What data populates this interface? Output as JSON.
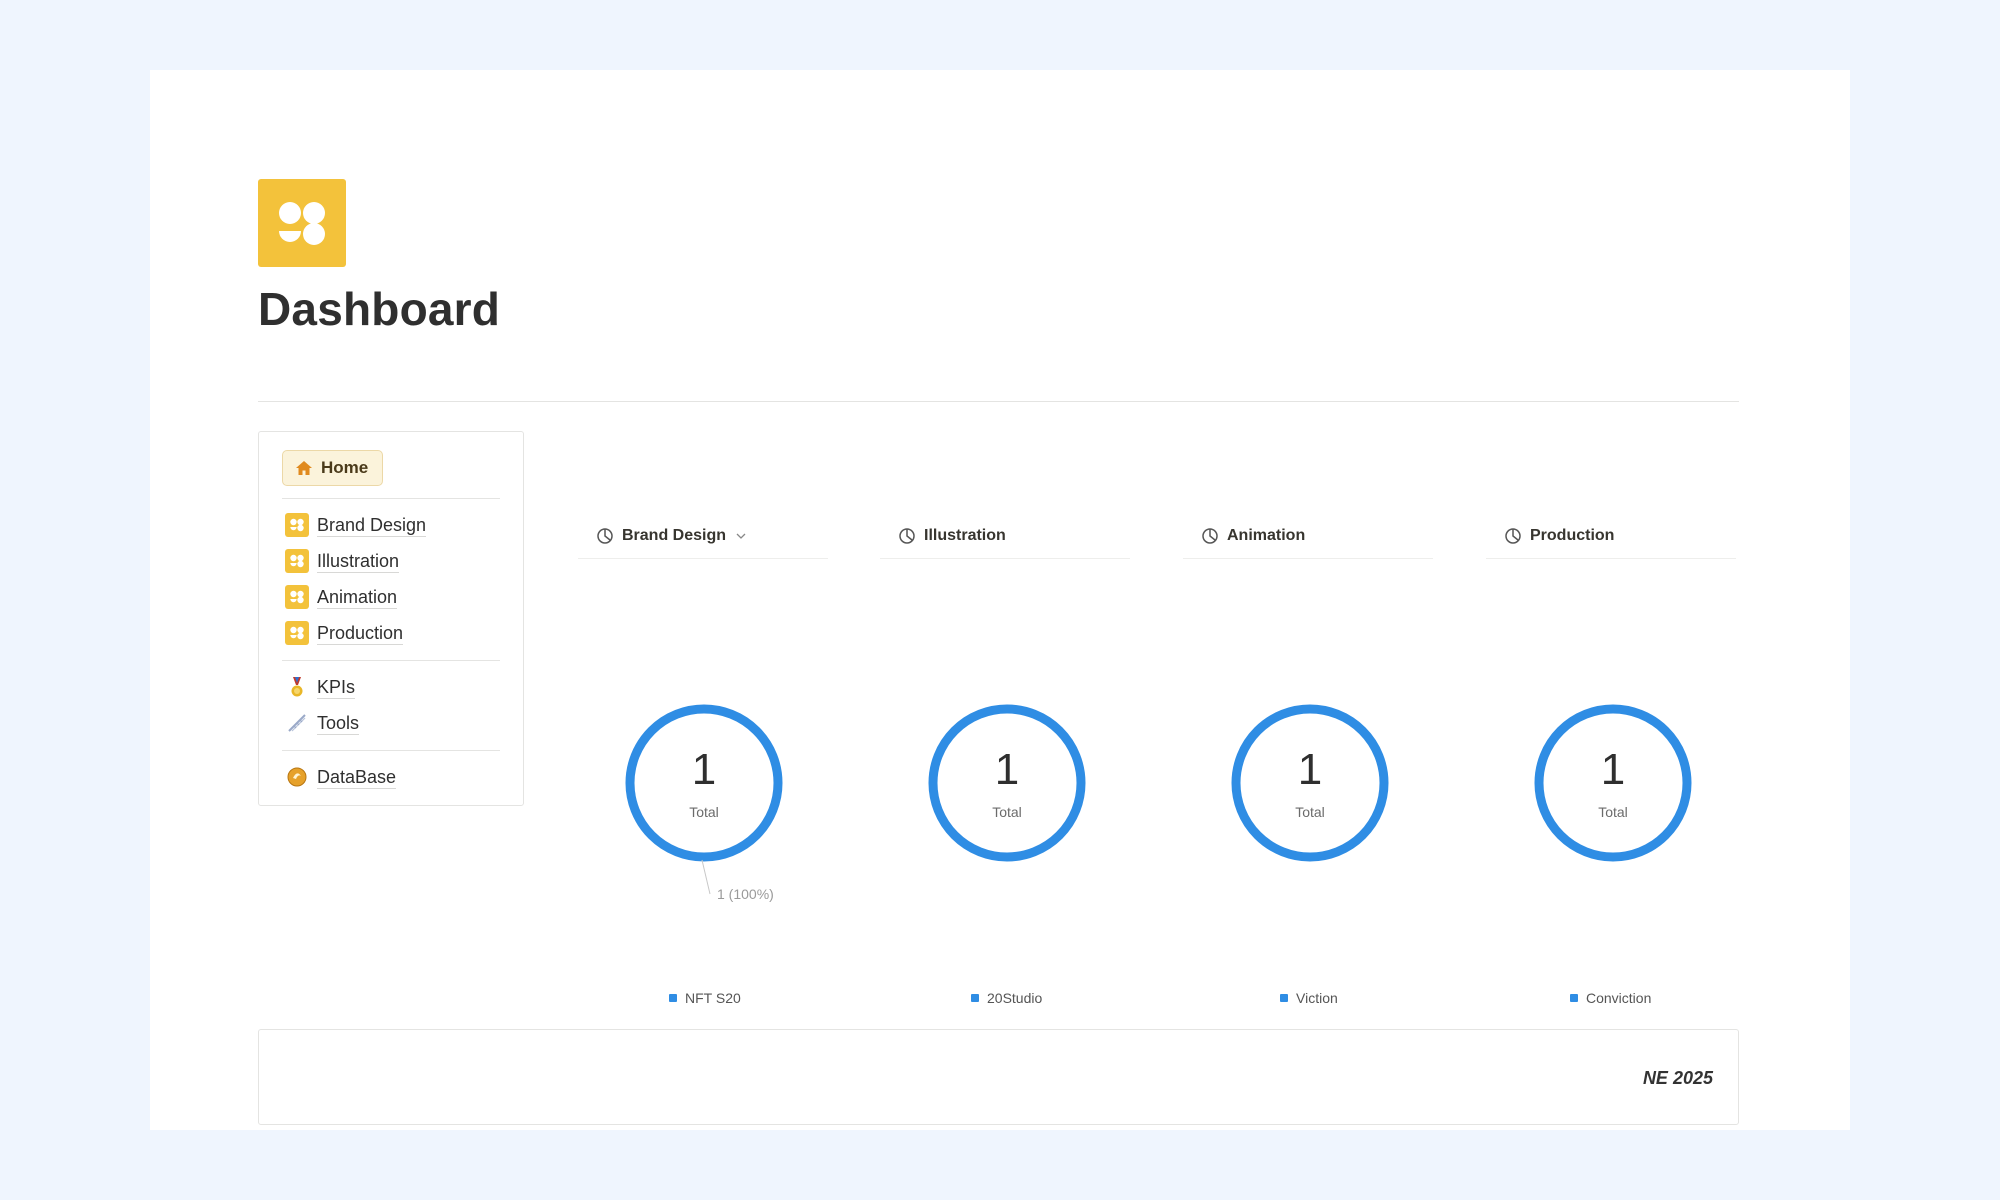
{
  "page": {
    "title": "Dashboard",
    "logo_icon": "yellow-dots-logo"
  },
  "nav": {
    "home": {
      "label": "Home",
      "icon": "house-icon"
    },
    "groups": [
      [
        {
          "label": "Brand Design",
          "icon": "yellow-dots-logo"
        },
        {
          "label": "Illustration",
          "icon": "yellow-dots-logo"
        },
        {
          "label": "Animation",
          "icon": "yellow-dots-logo"
        },
        {
          "label": "Production",
          "icon": "yellow-dots-logo"
        }
      ],
      [
        {
          "label": "KPIs",
          "icon": "medal-icon"
        },
        {
          "label": "Tools",
          "icon": "ruler-icon"
        }
      ],
      [
        {
          "label": "DataBase",
          "icon": "database-icon"
        }
      ]
    ]
  },
  "tabs": [
    {
      "label": "Brand Design",
      "icon": "pie-chart-icon",
      "has_dropdown": true
    },
    {
      "label": "Illustration",
      "icon": "pie-chart-icon",
      "has_dropdown": false
    },
    {
      "label": "Animation",
      "icon": "pie-chart-icon",
      "has_dropdown": false
    },
    {
      "label": "Production",
      "icon": "pie-chart-icon",
      "has_dropdown": false
    }
  ],
  "chart_data": [
    {
      "type": "pie",
      "style": "donut",
      "total": "1",
      "total_label": "Total",
      "slices": [
        {
          "name": "NFT S20",
          "value": 1
        }
      ],
      "annotation": "1 (100%)",
      "color": "#2f8de4",
      "legend": "bottom"
    },
    {
      "type": "pie",
      "style": "donut",
      "total": "1",
      "total_label": "Total",
      "slices": [
        {
          "name": "20Studio",
          "value": 1
        }
      ],
      "color": "#2f8de4",
      "legend": "bottom"
    },
    {
      "type": "pie",
      "style": "donut",
      "total": "1",
      "total_label": "Total",
      "slices": [
        {
          "name": "Viction",
          "value": 1
        }
      ],
      "color": "#2f8de4",
      "legend": "bottom"
    },
    {
      "type": "pie",
      "style": "donut",
      "total": "1",
      "total_label": "Total",
      "slices": [
        {
          "name": "Conviction",
          "value": 1
        }
      ],
      "color": "#2f8de4",
      "legend": "bottom"
    }
  ],
  "footer": {
    "text": "NE 2025"
  },
  "colors": {
    "accent": "#2f8de4",
    "brand": "#f3c23b",
    "home_bg": "#fbf3db"
  }
}
